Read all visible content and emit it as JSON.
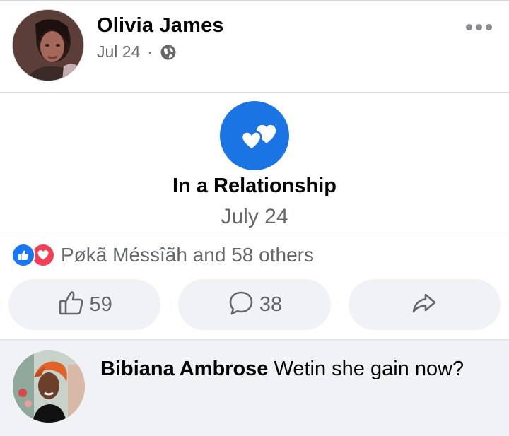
{
  "post": {
    "author": "Olivia James",
    "date": "Jul 24",
    "separator": "·",
    "privacy_icon": "globe-icon",
    "more_icon": "more-options-icon"
  },
  "life_event": {
    "icon": "hearts-icon",
    "title": "In a Relationship",
    "date": "July 24"
  },
  "reactions": {
    "icons": [
      "like-reaction-icon",
      "love-reaction-icon"
    ],
    "summary": "Pøkã Méssîãh and 58 others"
  },
  "actions": {
    "like_count": "59",
    "comment_count": "38",
    "share_icon": "share-icon"
  },
  "comment": {
    "author": "Bibiana Ambrose",
    "text": "Wetin she gain now?"
  },
  "colors": {
    "accent": "#1b74e4",
    "love": "#f33e58",
    "secondary_text": "#65676b",
    "button_bg": "#f0f2f5"
  }
}
